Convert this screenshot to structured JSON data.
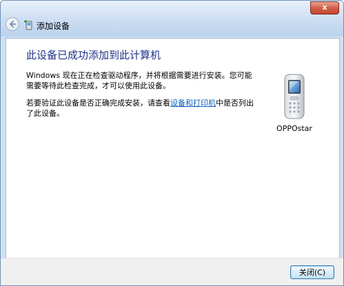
{
  "titlebar": {
    "title": "添加设备",
    "close_label": "x"
  },
  "content": {
    "heading": "此设备已成功添加到此计算机",
    "paragraph1": "Windows 现在正在检查驱动程序，并将根据需要进行安装。您可能需要等待此检查完成，才可以使用此设备。",
    "paragraph2_before": "若要验证此设备是否正确完成安装，请查看",
    "paragraph2_link": "设备和打印机",
    "paragraph2_after": "中是否列出了此设备。",
    "device_name": "OPPOstar"
  },
  "footer": {
    "close_button": "关闭(C)"
  },
  "icons": {
    "back": "back-arrow-icon",
    "title": "add-device-icon",
    "device": "mobile-phone-icon"
  },
  "colors": {
    "heading": "#1e3287",
    "link": "#0b5fbf",
    "close": "#c4452d"
  }
}
